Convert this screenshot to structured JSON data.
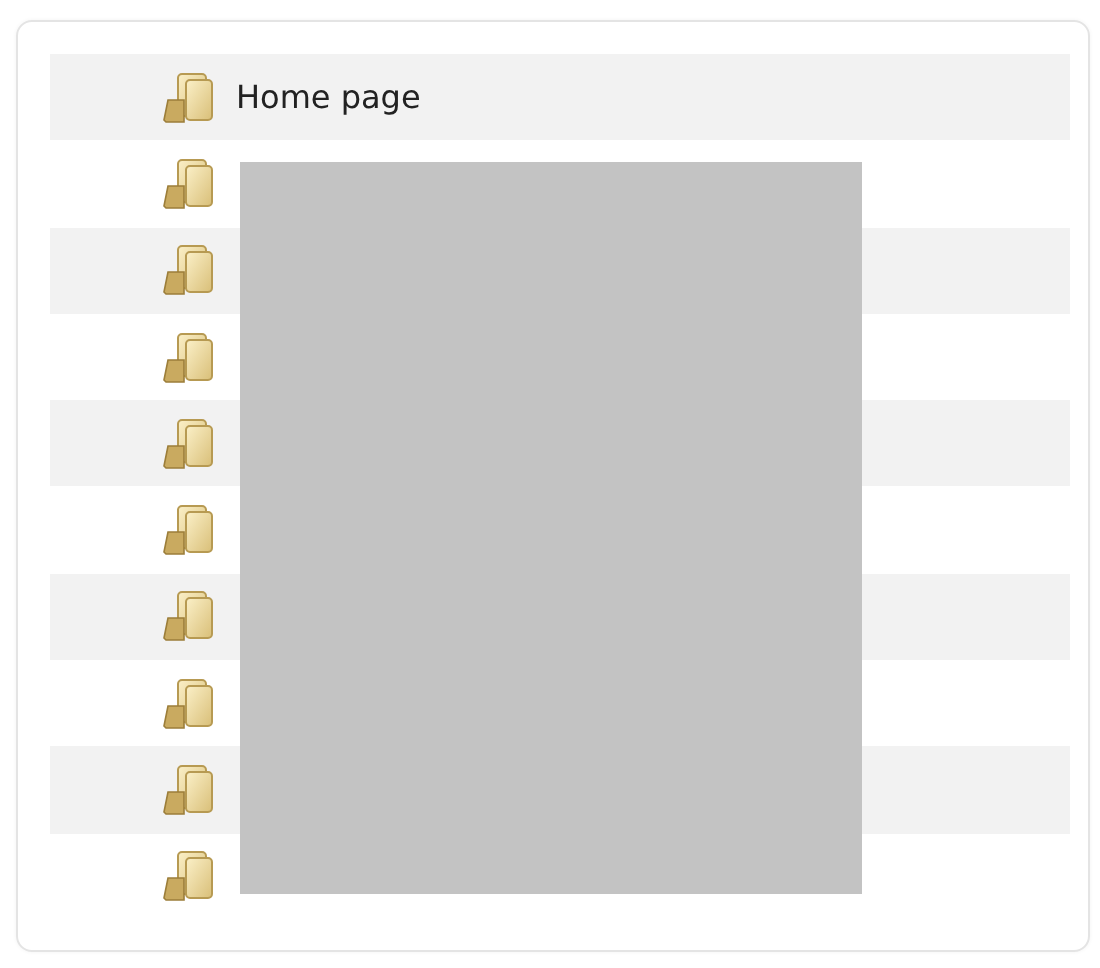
{
  "folders": [
    {
      "kind": "folder",
      "label": "Home page"
    },
    {
      "kind": "folder"
    },
    {
      "kind": "folder"
    },
    {
      "kind": "folder"
    },
    {
      "kind": "folder"
    },
    {
      "kind": "folder"
    },
    {
      "kind": "folder"
    },
    {
      "kind": "folder"
    },
    {
      "kind": "folder"
    },
    {
      "kind": "folder"
    }
  ]
}
